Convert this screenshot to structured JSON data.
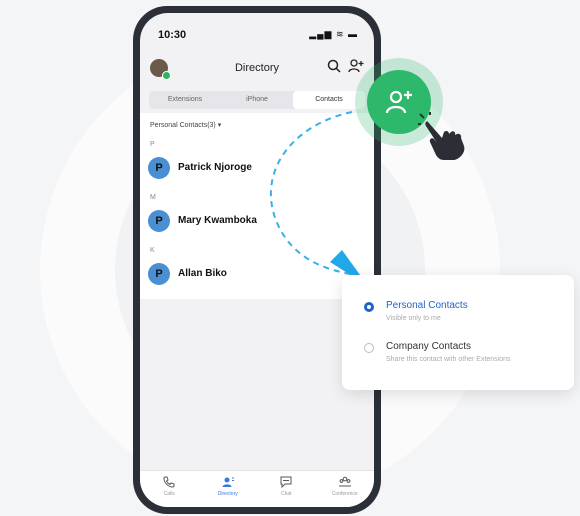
{
  "status": {
    "time": "10:30",
    "icons": "▂▄▆ ≋ ▬"
  },
  "header": {
    "title": "Directory",
    "search_icon": "search-icon",
    "add_icon": "add-contact-icon"
  },
  "tabs": [
    {
      "label": "Extensions",
      "active": false
    },
    {
      "label": "iPhone",
      "active": false
    },
    {
      "label": "Contacts",
      "active": true
    }
  ],
  "list": {
    "section_label": "Personal Contacts(3)",
    "sections": [
      {
        "letter": "P",
        "contact": {
          "initial": "P",
          "name": "Patrick Njoroge"
        }
      },
      {
        "letter": "M",
        "contact": {
          "initial": "P",
          "name": "Mary Kwamboka"
        }
      },
      {
        "letter": "K",
        "contact": {
          "initial": "P",
          "name": "Allan Biko"
        }
      }
    ]
  },
  "bottom_nav": [
    {
      "label": "Calls",
      "icon": "phone-icon",
      "active": false
    },
    {
      "label": "Directory",
      "icon": "contacts-icon",
      "active": true
    },
    {
      "label": "Chat",
      "icon": "chat-icon",
      "active": false
    },
    {
      "label": "Conference",
      "icon": "conference-icon",
      "active": false
    }
  ],
  "popup": {
    "options": [
      {
        "title": "Personal Contacts",
        "subtitle": "Visible only to me",
        "selected": true
      },
      {
        "title": "Company Contacts",
        "subtitle": "Share this contact with other Extensions",
        "selected": false
      }
    ]
  },
  "colors": {
    "accent_green": "#2eb86c",
    "accent_blue": "#1e64c8",
    "avatar_blue": "#4a8fd1",
    "dash_blue": "#3ab0e8"
  }
}
